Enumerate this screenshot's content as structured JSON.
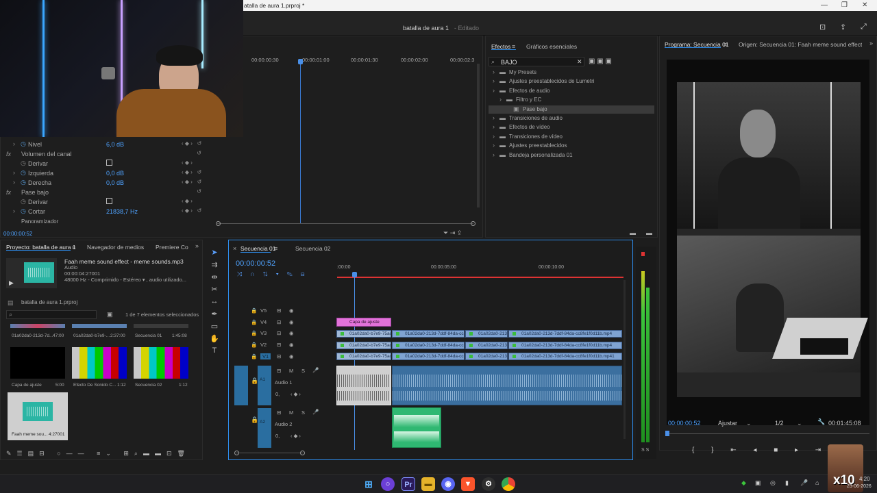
{
  "window": {
    "title": "atalla de aura 1.prproj *",
    "doc_title": "batalla de aura 1",
    "edit_state": "- Editado"
  },
  "source_monitor": {
    "ruler": [
      "00:00:00:30",
      "00:00:01:00",
      "00:00:01:30",
      "00:00:02:00",
      "00:00:02:3"
    ],
    "playhead_fraction": 0.2,
    "params": [
      {
        "label": "Nivel",
        "value": "6,0 dB"
      },
      {
        "label": "Volumen del canal",
        "value": ""
      },
      {
        "label": "Derivar",
        "value": ""
      },
      {
        "label": "Izquierda",
        "value": "0,0 dB"
      },
      {
        "label": "Derecha",
        "value": "0,0 dB"
      },
      {
        "label": "Pase bajo",
        "value": ""
      },
      {
        "label": "Derivar",
        "value": ""
      },
      {
        "label": "Cortar",
        "value": "21838,7 Hz"
      },
      {
        "label": "Panoramizador",
        "value": ""
      }
    ],
    "timecode": "00:00:00:52"
  },
  "effects": {
    "tabs": [
      "Efectos",
      "Gráficos esenciales"
    ],
    "search": "BAJO",
    "tree": [
      {
        "label": "My Presets",
        "level": 0,
        "selected": false
      },
      {
        "label": "Ajustes preestablecidos de Lumetri",
        "level": 0,
        "selected": false
      },
      {
        "label": "Efectos de audio",
        "level": 0,
        "selected": false
      },
      {
        "label": "Filtro y EC",
        "level": 1,
        "selected": false
      },
      {
        "label": "Pase bajo",
        "level": 2,
        "selected": true
      },
      {
        "label": "Transiciones de audio",
        "level": 0,
        "selected": false
      },
      {
        "label": "Efectos de vídeo",
        "level": 0,
        "selected": false
      },
      {
        "label": "Transiciones de vídeo",
        "level": 0,
        "selected": false
      },
      {
        "label": "Ajustes preestablecidos",
        "level": 0,
        "selected": false
      },
      {
        "label": "Bandeja personalizada 01",
        "level": 0,
        "selected": false
      }
    ]
  },
  "program": {
    "tab": "Programa: Secuencia 01",
    "origin_tab": "Origen: Secuencia 01: Faah meme sound effect - mem",
    "timecode": "00:00:00:52",
    "fit": "Ajustar",
    "quality": "1/2",
    "duration": "00:01:45:08"
  },
  "project": {
    "tabs": [
      "Proyecto: batalla de aura 1",
      "Navegador de medios",
      "Premiere Co"
    ],
    "clip_title": "Faah meme sound effect - meme sounds.mp3",
    "clip_type": "Audio",
    "clip_duration": "00:00:04:27001",
    "clip_info": "48000 Hz - Comprimido - Estéreo ▾ , audio utilizado...",
    "project_file": "batalla de aura 1.prproj",
    "selection": "1 de 7 elementos seleccionados",
    "items": [
      {
        "name": "01a02da0-213d-7d...",
        "dur": "47:00"
      },
      {
        "name": "01a02da0-b7e9-...",
        "dur": "2:37:00"
      },
      {
        "name": "Secuencia 01",
        "dur": "1:45:08"
      },
      {
        "name": "Capa de ajuste",
        "dur": "5:00"
      },
      {
        "name": "Efecto De Sonido C...",
        "dur": "1:12"
      },
      {
        "name": "Secuencia 02",
        "dur": "1:12"
      },
      {
        "name": "Faah meme sou...",
        "dur": "4:27001"
      }
    ]
  },
  "timeline": {
    "tabs": [
      "Secuencia 01",
      "Secuencia 02"
    ],
    "timecode": "00:00:00:52",
    "ruler": [
      ":00:00",
      "00:00:05:00",
      "00:00:10:00"
    ],
    "video_tracks": [
      "V5",
      "V4",
      "V3",
      "V2",
      "V1"
    ],
    "audio_tracks": [
      {
        "id": "A1",
        "name": "Audio 1",
        "vol": "0,"
      },
      {
        "id": "A2",
        "name": "Audio 2",
        "vol": "0,"
      }
    ],
    "adjustment_clip": "Capa de ajuste",
    "clips": {
      "v3": [
        "01a02da0-b7e9-75ac",
        "01a02da0-213d-7ddf-84da-cc8f",
        "01a02da0-213d",
        "01a02da0-213d-7ddf-84da-cc8fe1f0d11b.mp4"
      ],
      "v2": [
        "01a02da0-b7e9-75ac",
        "01a02da0-213d-7ddf-84da-cc8f",
        "01a02da0-213d",
        "01a02da0-213d-7ddf-84da-cc8fe1f0d11b.mp4"
      ],
      "v1": [
        "01a02da0-b7e9-75ac",
        "01a02da0-213d-7ddf-84da-cc8f",
        "01a02da0-213d",
        "01a02da0-213d-7ddf-84da-cc8fe1f0d11b.mp41"
      ]
    },
    "track_btns": [
      "M",
      "S"
    ]
  },
  "meter": {
    "scale": "S S"
  },
  "taskbar": {
    "time": "4:20",
    "date": "23-06-2026",
    "badge": "x10"
  },
  "colors": {
    "accent": "#2d8ceb",
    "adjust": "#e272d9",
    "video_clip": "#7fa3d2",
    "audio_clip": "#2fb872"
  }
}
